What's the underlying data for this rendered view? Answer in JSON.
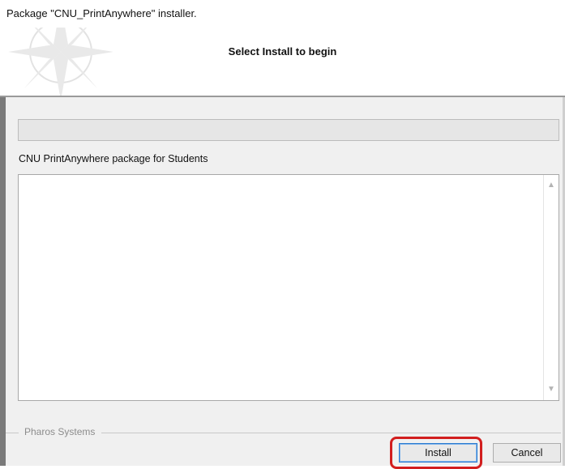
{
  "window": {
    "title": "Package \"CNU_PrintAnywhere\" installer."
  },
  "banner": {
    "heading": "Select Install to begin",
    "logo_icon": "compass-star-icon"
  },
  "progress": {
    "value": 0
  },
  "content": {
    "package_label": "CNU PrintAnywhere package for Students",
    "description": ""
  },
  "footer": {
    "vendor": "Pharos Systems",
    "install_label": "Install",
    "cancel_label": "Cancel"
  },
  "colors": {
    "highlight": "#d21e1e",
    "default_button_border": "#2b7bd0"
  }
}
